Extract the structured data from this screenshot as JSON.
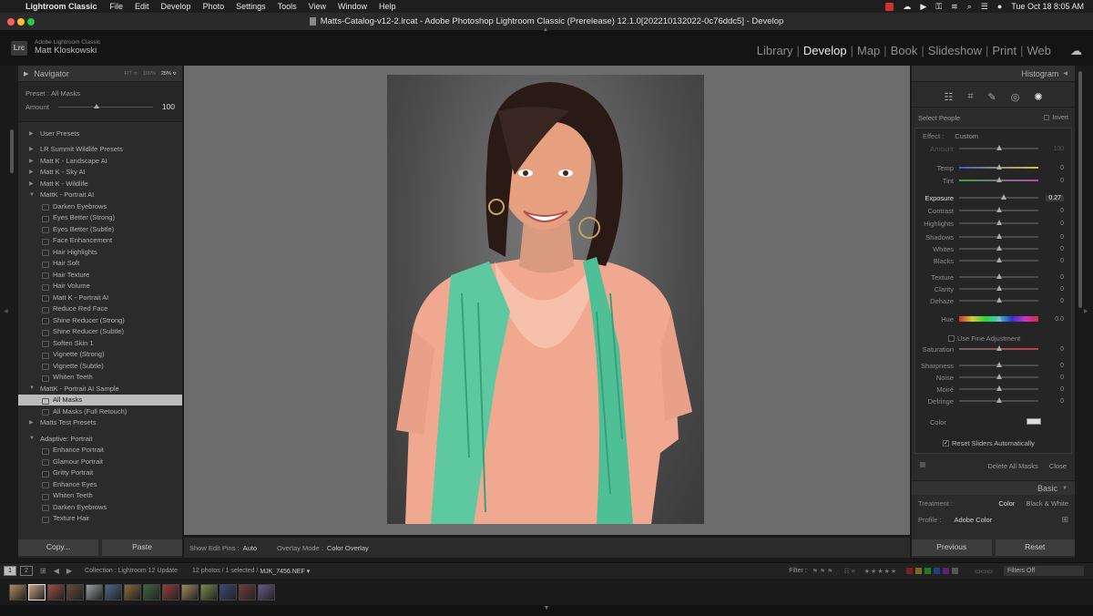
{
  "menubar": {
    "app": "Lightroom Classic",
    "items": [
      "File",
      "Edit",
      "Develop",
      "Photo",
      "Settings",
      "Tools",
      "View",
      "Window",
      "Help"
    ],
    "datetime": "Tue Oct 18  8:05 AM"
  },
  "window": {
    "title": "Matts-Catalog-v12-2.lrcat - Adobe Photoshop Lightroom Classic (Prerelease) 12.1.0[202210132022-0c76ddc5] - Develop"
  },
  "identity": {
    "badge": "Lrc",
    "product": "Adobe Lightroom Classic",
    "user": "Matt Kloskowski"
  },
  "modules": [
    {
      "label": "Library",
      "active": false
    },
    {
      "label": "Develop",
      "active": true
    },
    {
      "label": "Map",
      "active": false
    },
    {
      "label": "Book",
      "active": false
    },
    {
      "label": "Slideshow",
      "active": false
    },
    {
      "label": "Print",
      "active": false
    },
    {
      "label": "Web",
      "active": false
    }
  ],
  "navigator": {
    "title": "Navigator",
    "zoom": [
      "FIT ≎",
      "100%",
      "25% ≎"
    ]
  },
  "preview": {
    "preset_label": "Preset :",
    "preset_value": "All Masks",
    "amount_label": "Amount",
    "amount_value": "100",
    "amount_level": 0.38
  },
  "presets": [
    {
      "type": "folder",
      "label": "User Presets",
      "open": false,
      "gap": true
    },
    {
      "type": "folder",
      "label": "LR Summit Wildlife Presets",
      "open": false
    },
    {
      "type": "folder",
      "label": "Matt K - Landscape AI",
      "open": false
    },
    {
      "type": "folder",
      "label": "Matt K - Sky AI",
      "open": false
    },
    {
      "type": "folder",
      "label": "Matt K - Wildlife",
      "open": false
    },
    {
      "type": "folder",
      "label": "MattK - Portrait AI",
      "open": true
    },
    {
      "type": "item",
      "label": "Darken Eyebrows"
    },
    {
      "type": "item",
      "label": "Eyes Better (Strong)"
    },
    {
      "type": "item",
      "label": "Eyes Better (Subtle)"
    },
    {
      "type": "item",
      "label": "Face Enhancement"
    },
    {
      "type": "item",
      "label": "Hair Highlights"
    },
    {
      "type": "item",
      "label": "Hair Soft"
    },
    {
      "type": "item",
      "label": "Hair Texture"
    },
    {
      "type": "item",
      "label": "Hair Volume"
    },
    {
      "type": "item",
      "label": "Matt K - Portrait AI"
    },
    {
      "type": "item",
      "label": "Reduce Red Face"
    },
    {
      "type": "item",
      "label": "Shine Reducer (Strong)"
    },
    {
      "type": "item",
      "label": "Shine Reducer (Subtle)"
    },
    {
      "type": "item",
      "label": "Soften Skin 1"
    },
    {
      "type": "item",
      "label": "Vignette (Strong)"
    },
    {
      "type": "item",
      "label": "Vignette (Subtle)"
    },
    {
      "type": "item",
      "label": "Whiten Teeth"
    },
    {
      "type": "folder",
      "label": "MattK - Portrait AI Sample",
      "open": true
    },
    {
      "type": "item",
      "label": "All Masks",
      "selected": true
    },
    {
      "type": "item",
      "label": "All Masks (Full Retouch)"
    },
    {
      "type": "folder",
      "label": "Matts Test Presets",
      "open": false,
      "gap": true
    },
    {
      "type": "folder",
      "label": "Adaptive: Portrait",
      "open": true
    },
    {
      "type": "item",
      "label": "Enhance Portrait"
    },
    {
      "type": "item",
      "label": "Glamour Portrait"
    },
    {
      "type": "item",
      "label": "Gritty Portrait"
    },
    {
      "type": "item",
      "label": "Enhance Eyes"
    },
    {
      "type": "item",
      "label": "Whiten Teeth"
    },
    {
      "type": "item",
      "label": "Darken Eyebrows"
    },
    {
      "type": "item",
      "label": "Texture Hair"
    }
  ],
  "left_buttons": {
    "copy": "Copy...",
    "paste": "Paste"
  },
  "toolbar": {
    "pins_label": "Show Edit Pins :",
    "pins_value": "Auto",
    "overlay_label": "Overlay Mode :",
    "overlay_value": "Color Overlay"
  },
  "right": {
    "histogram": "Histogram",
    "select_people": "Select People",
    "invert": "Invert",
    "effect_label": "Effect :",
    "effect_value": "Custom",
    "sliders": [
      {
        "label": "Amount",
        "value": "100",
        "pos": 0.5,
        "dim": true
      },
      {
        "label": "Temp",
        "value": "0",
        "pos": 0.5,
        "grad": "linear-gradient(90deg,#3a5fbf,#d8c040)"
      },
      {
        "label": "Tint",
        "value": "0",
        "pos": 0.5,
        "grad": "linear-gradient(90deg,#3fa040,#b04ab0)"
      },
      {
        "label": "Exposure",
        "value": "0.27",
        "pos": 0.56,
        "hl": true
      },
      {
        "label": "Contrast",
        "value": "0",
        "pos": 0.5
      },
      {
        "label": "Highlights",
        "value": "0",
        "pos": 0.5
      },
      {
        "label": "Shadows",
        "value": "0",
        "pos": 0.5
      },
      {
        "label": "Whites",
        "value": "0",
        "pos": 0.5
      },
      {
        "label": "Blacks",
        "value": "0",
        "pos": 0.5
      },
      {
        "label": "Texture",
        "value": "0",
        "pos": 0.5
      },
      {
        "label": "Clarity",
        "value": "0",
        "pos": 0.5
      },
      {
        "label": "Dehaze",
        "value": "0",
        "pos": 0.5
      },
      {
        "label": "Hue",
        "value": "0.0",
        "pos": 0.5,
        "grad": "linear-gradient(90deg,#d03030,#d0d030,#30d030,#30d0d0,#3030d0,#d030d0,#d03030)",
        "thick": true
      },
      {
        "label": "Saturation",
        "value": "0",
        "pos": 0.5,
        "grad": "linear-gradient(90deg,#666,#c04040)"
      },
      {
        "label": "Sharpness",
        "value": "0",
        "pos": 0.5
      },
      {
        "label": "Noise",
        "value": "0",
        "pos": 0.5
      },
      {
        "label": "Moiré",
        "value": "0",
        "pos": 0.5
      },
      {
        "label": "Defringe",
        "value": "0",
        "pos": 0.5
      }
    ],
    "fine_adjust": "Use Fine Adjustment",
    "color_label": "Color",
    "reset_sliders": "Reset Sliders Automatically",
    "delete_all": "Delete All Masks",
    "close": "Close",
    "basic": "Basic",
    "treatment_label": "Treatment :",
    "treatment_color": "Color",
    "treatment_bw": "Black & White",
    "profile_label": "Profile :",
    "profile_value": "Adobe Color",
    "previous": "Previous",
    "reset": "Reset"
  },
  "filmstrip": {
    "screen1": "1",
    "screen2": "2",
    "collection": "Collection : Lightroom 12 Update",
    "count": "12 photos / 1 selected /",
    "file": "MJK_7456.NEF ▾",
    "filter_label": "Filter :",
    "filters_off": "Filters Off",
    "thumb_colors": [
      "#b08a60",
      "#c9a080",
      "#9a5040",
      "#6a4a3a",
      "#9aa0a8",
      "#4a6a8a",
      "#8a6a3a",
      "#3a6a3a",
      "#9a3a3a",
      "#a08a5a",
      "#7a8a4a",
      "#3a4a7a",
      "#7a3a3a",
      "#6a5a8a"
    ]
  }
}
